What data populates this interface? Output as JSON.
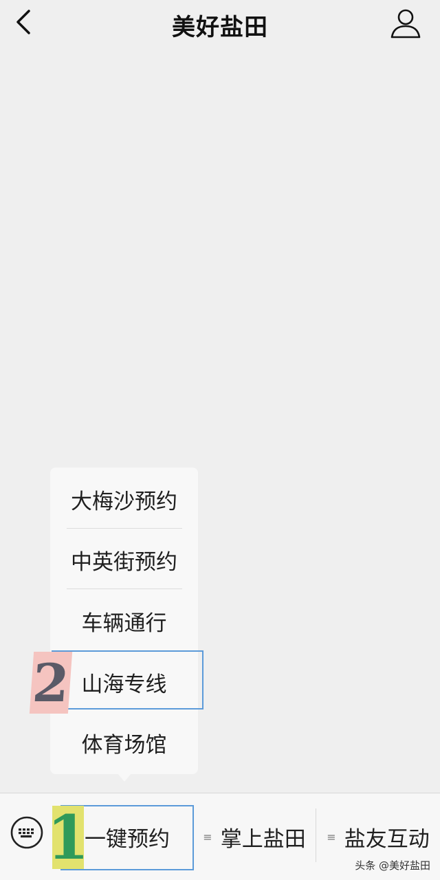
{
  "navbar": {
    "title": "美好盐田",
    "back_icon": "chevron-left-icon",
    "profile_icon": "person-icon"
  },
  "popup_menu": {
    "items": [
      {
        "label": "大梅沙预约"
      },
      {
        "label": "中英街预约"
      },
      {
        "label": "车辆通行"
      },
      {
        "label": "山海专线"
      },
      {
        "label": "体育场馆"
      }
    ],
    "highlighted_item_index": 3,
    "highlight_badge": "2"
  },
  "bottom_menu": {
    "keyboard_icon": "keyboard-icon",
    "tabs": [
      {
        "label": "一键预约",
        "has_submenu_icon": false
      },
      {
        "label": "掌上盐田",
        "has_submenu_icon": true,
        "icon": "≡"
      },
      {
        "label": "盐友互动",
        "has_submenu_icon": true,
        "icon": "≡"
      }
    ],
    "highlight_badge": "1"
  },
  "watermark": "头条 @美好盐田",
  "colors": {
    "background": "#efefef",
    "highlight": "#5b9ad9",
    "badge_pink": "#f5c4c0",
    "badge_yellow": "#e2e26e",
    "badge_green": "#2f9a5a"
  }
}
